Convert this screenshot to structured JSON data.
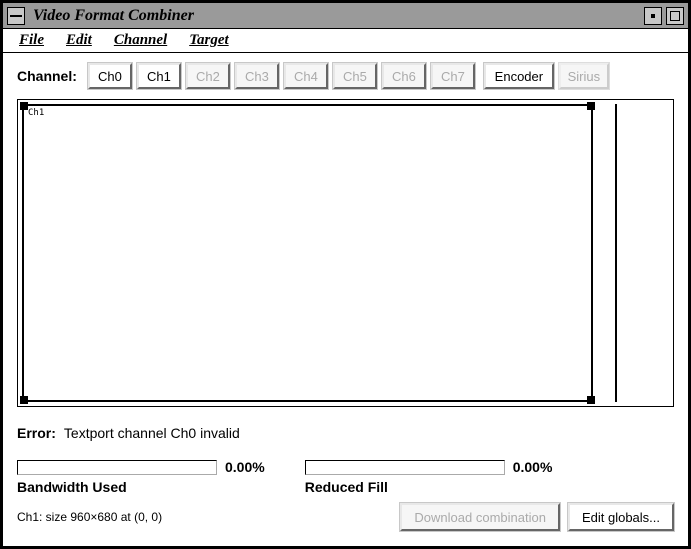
{
  "window": {
    "title": "Video Format Combiner"
  },
  "menu": {
    "file": "File",
    "edit": "Edit",
    "channel": "Channel",
    "target": "Target"
  },
  "channel_row": {
    "label": "Channel:",
    "buttons": [
      {
        "label": "Ch0",
        "enabled": true
      },
      {
        "label": "Ch1",
        "enabled": true
      },
      {
        "label": "Ch2",
        "enabled": false
      },
      {
        "label": "Ch3",
        "enabled": false
      },
      {
        "label": "Ch4",
        "enabled": false
      },
      {
        "label": "Ch5",
        "enabled": false
      },
      {
        "label": "Ch6",
        "enabled": false
      },
      {
        "label": "Ch7",
        "enabled": false
      }
    ],
    "encoder": "Encoder",
    "sirius": "Sirius"
  },
  "canvas": {
    "active_label": "Ch1"
  },
  "error": {
    "label": "Error:",
    "message": "Textport channel Ch0 invalid"
  },
  "meters": {
    "bandwidth": {
      "value": "0.00%",
      "label": "Bandwidth Used"
    },
    "fill": {
      "value": "0.00%",
      "label": "Reduced Fill"
    }
  },
  "status": "Ch1: size 960×680 at (0, 0)",
  "footer": {
    "download": "Download combination",
    "editglobals": "Edit globals..."
  }
}
